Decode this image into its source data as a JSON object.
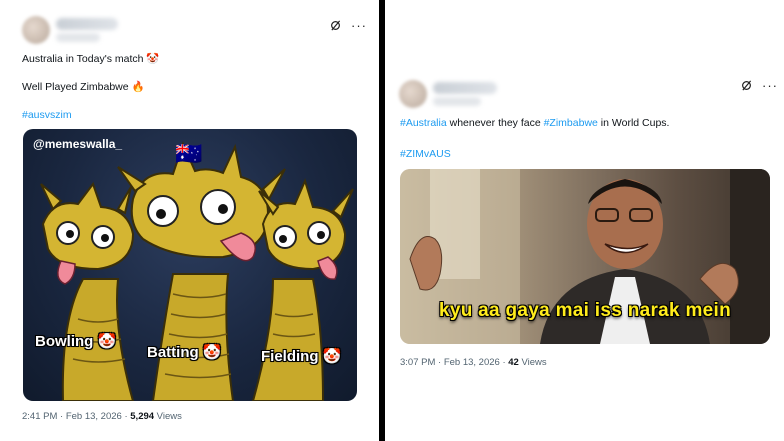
{
  "left_tweet": {
    "line1": "Australia in Today's match 🤡",
    "line2": "Well Played Zimbabwe 🔥",
    "hashtag": "#ausvszim",
    "meme": {
      "watermark": "@memeswalla_",
      "flag": "🇦🇺",
      "labels": {
        "bowling": "Bowling 🤡",
        "batting": "Batting 🤡",
        "fielding": "Fielding 🤡"
      }
    },
    "time": "2:41 PM · Feb 13, 2026 · ",
    "views_count": "5,294",
    "views_label": " Views"
  },
  "right_tweet": {
    "tag1": "#Australia",
    "mid_text": " whenever they face ",
    "tag2": "#Zimbabwe",
    "end_text": " in World Cups.",
    "hashtag": "#ZIMvAUS",
    "meme": {
      "subtitle": "kyu aa gaya mai iss narak mein"
    },
    "time": "3:07 PM · Feb 13, 2026 · ",
    "views_count": "42",
    "views_label": " Views"
  },
  "icons": {
    "grok": "grok-icon",
    "more": "more-options-icon"
  },
  "colors": {
    "link": "#1d9bf0",
    "divider": "#000000",
    "subtitle": "#ffec1c"
  }
}
